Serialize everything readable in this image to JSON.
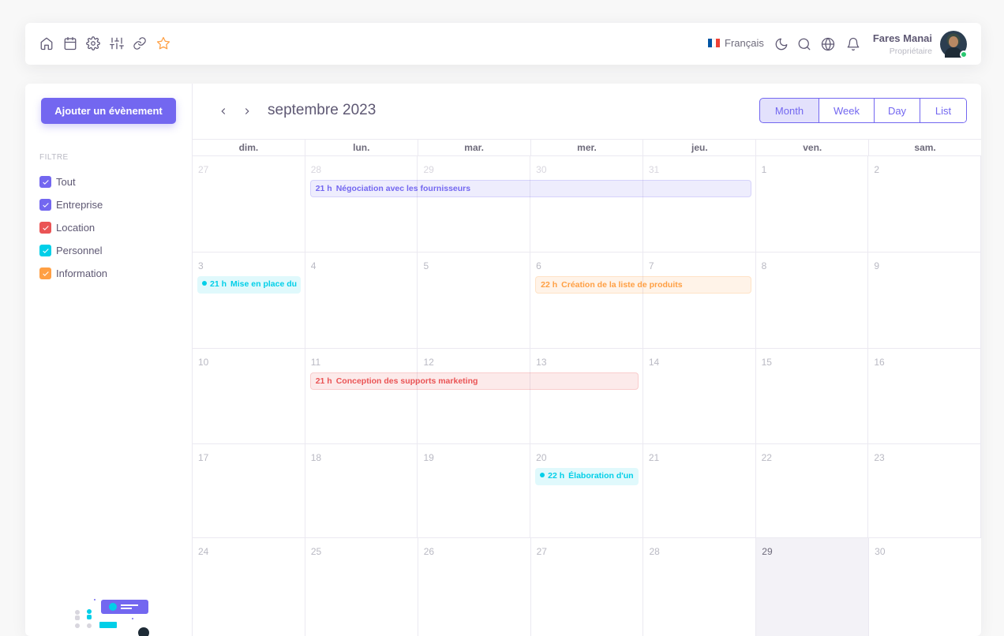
{
  "topbar": {
    "icons": [
      "home-icon",
      "calendar-icon",
      "settings-icon",
      "sliders-icon",
      "link-icon",
      "star-icon"
    ],
    "language": "Français",
    "user_name": "Fares Manai",
    "user_role": "Propriétaire"
  },
  "sidebar": {
    "add_button": "Ajouter un évènement",
    "filter_title": "FILTRE",
    "filters": [
      {
        "label": "Tout",
        "color": "#7367f0"
      },
      {
        "label": "Entreprise",
        "color": "#7367f0"
      },
      {
        "label": "Location",
        "color": "#ea5455"
      },
      {
        "label": "Personnel",
        "color": "#00cfe8"
      },
      {
        "label": "Information",
        "color": "#ff9f43"
      }
    ]
  },
  "calendar": {
    "title": "septembre 2023",
    "views": [
      "Month",
      "Week",
      "Day",
      "List"
    ],
    "active_view": "Month",
    "weekdays": [
      "dim.",
      "lun.",
      "mar.",
      "mer.",
      "jeu.",
      "ven.",
      "sam."
    ],
    "weeks": [
      [
        "27",
        "28",
        "29",
        "30",
        "31",
        "1",
        "2"
      ],
      [
        "3",
        "4",
        "5",
        "6",
        "7",
        "8",
        "9"
      ],
      [
        "10",
        "11",
        "12",
        "13",
        "14",
        "15",
        "16"
      ],
      [
        "17",
        "18",
        "19",
        "20",
        "21",
        "22",
        "23"
      ],
      [
        "24",
        "25",
        "26",
        "27",
        "28",
        "29",
        "30"
      ]
    ],
    "today": "29",
    "events": [
      {
        "time": "21 h",
        "title": "Négociation avec les fournisseurs",
        "category": "Entreprise",
        "color": "#7367f0"
      },
      {
        "time": "21 h",
        "title": "Mise en place du",
        "category": "Personnel",
        "color": "#00cfe8"
      },
      {
        "time": "22 h",
        "title": "Création de la liste de produits",
        "category": "Information",
        "color": "#ff9f43"
      },
      {
        "time": "21 h",
        "title": "Conception des supports marketing",
        "category": "Location",
        "color": "#ea5455"
      },
      {
        "time": "22 h",
        "title": "Élaboration d'un",
        "category": "Personnel",
        "color": "#00cfe8"
      }
    ]
  }
}
